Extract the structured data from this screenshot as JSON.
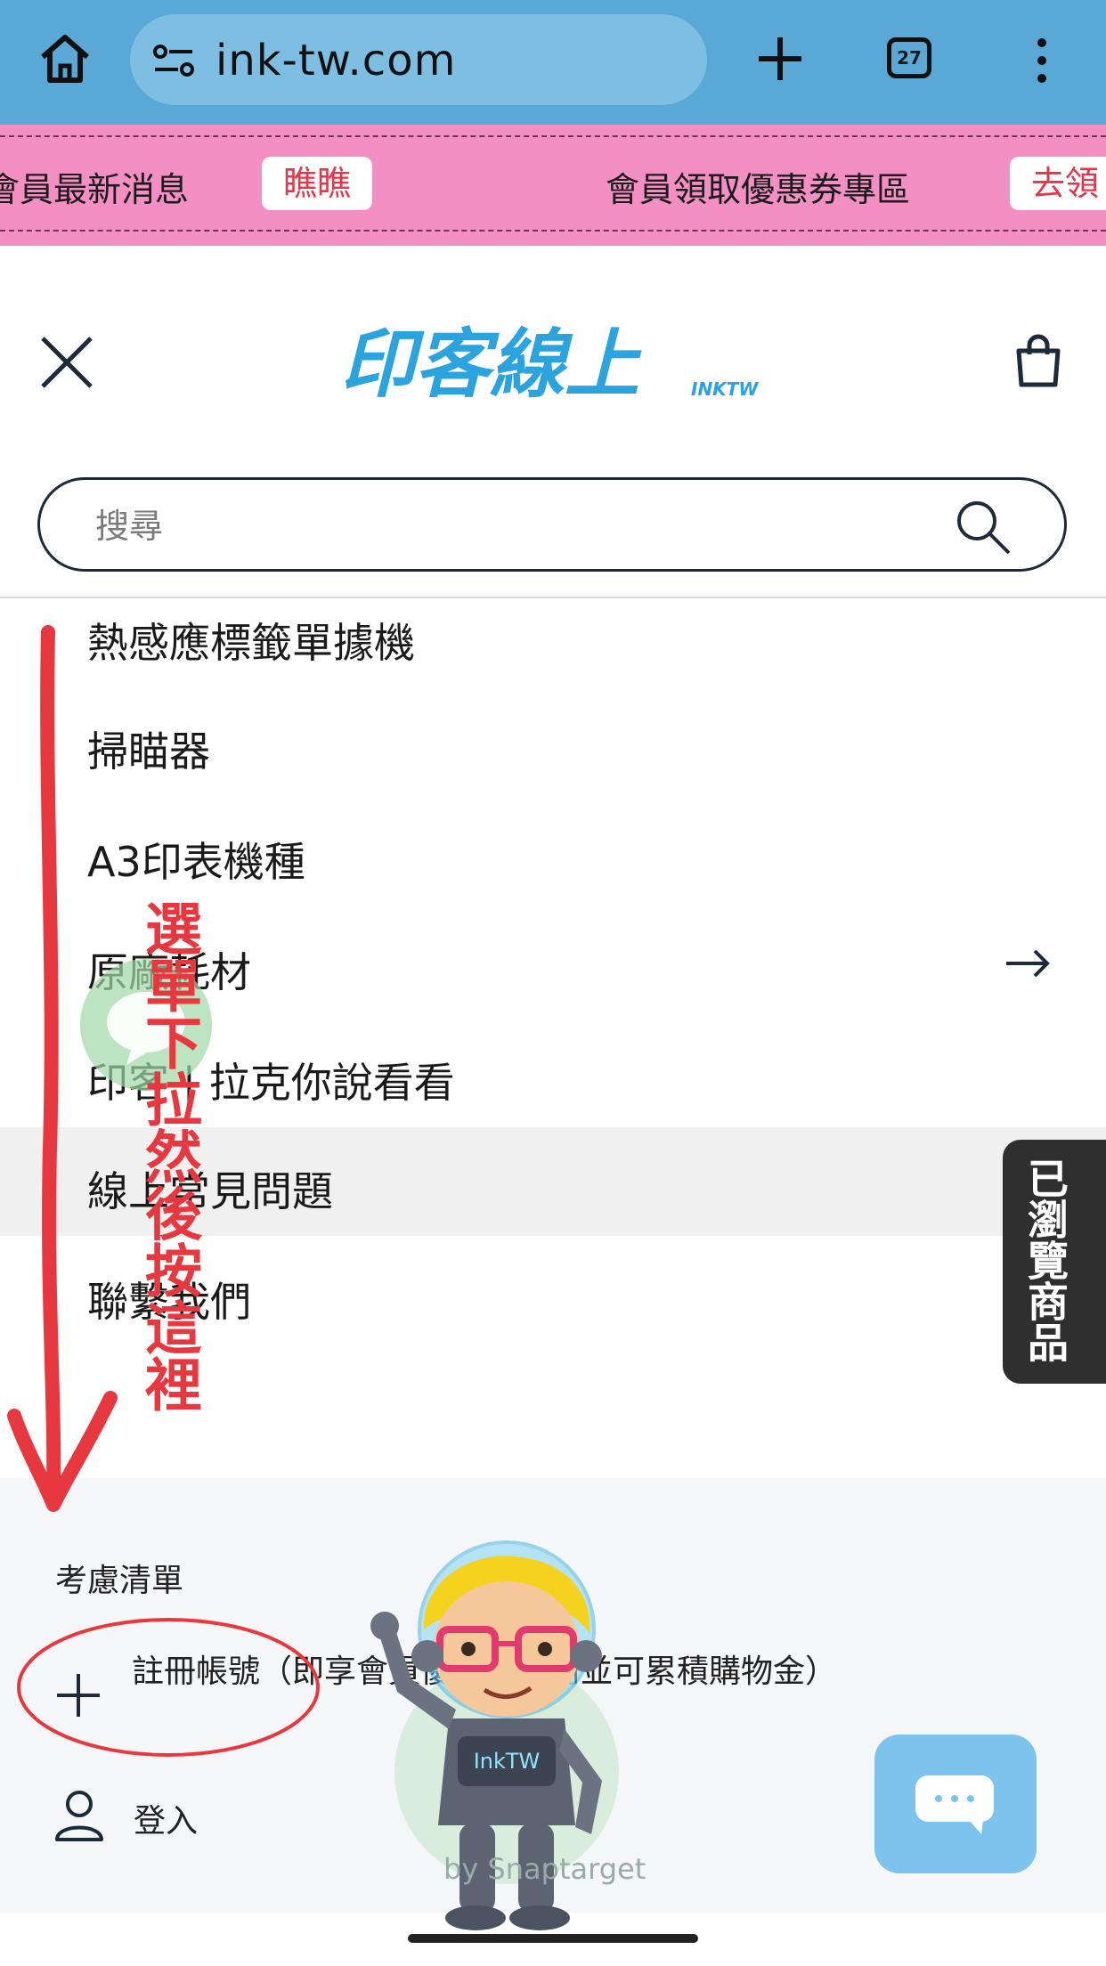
{
  "browser": {
    "url": "ink-tw.com",
    "tab_count": "27"
  },
  "announcement": {
    "items": [
      {
        "text": "會員最新消息",
        "button": "瞧瞧"
      },
      {
        "text": "會員領取優惠券專區",
        "button": "去領"
      }
    ]
  },
  "header": {
    "logo_text": "印客線上",
    "logo_sub": "INKTW"
  },
  "search": {
    "placeholder": "搜尋"
  },
  "menu": {
    "items": [
      {
        "label": "熱感應標籤單據機"
      },
      {
        "label": "掃瞄器"
      },
      {
        "label": "A3印表機種"
      },
      {
        "label": "原廠耗材"
      },
      {
        "label": "印客 | 拉克你說看看"
      },
      {
        "label": "線上常見問題"
      },
      {
        "label": "聯繫我們"
      }
    ]
  },
  "account": {
    "wishlist_label": "考慮清單",
    "register_label": "註冊帳號（即享會員優惠可使用並可累積購物金）",
    "login_label": "登入"
  },
  "recently_viewed": {
    "label": "已瀏覽商品"
  },
  "annotation": {
    "instruction": "選單下拉然後按這裡"
  },
  "widget": {
    "credit": "by Snaptarget"
  },
  "colors": {
    "browser_bar": "#5aa8d6",
    "announcement_bg": "#f48fc4",
    "annotation_red": "#e8383f",
    "chat_bubble": "#7cc3ee"
  }
}
